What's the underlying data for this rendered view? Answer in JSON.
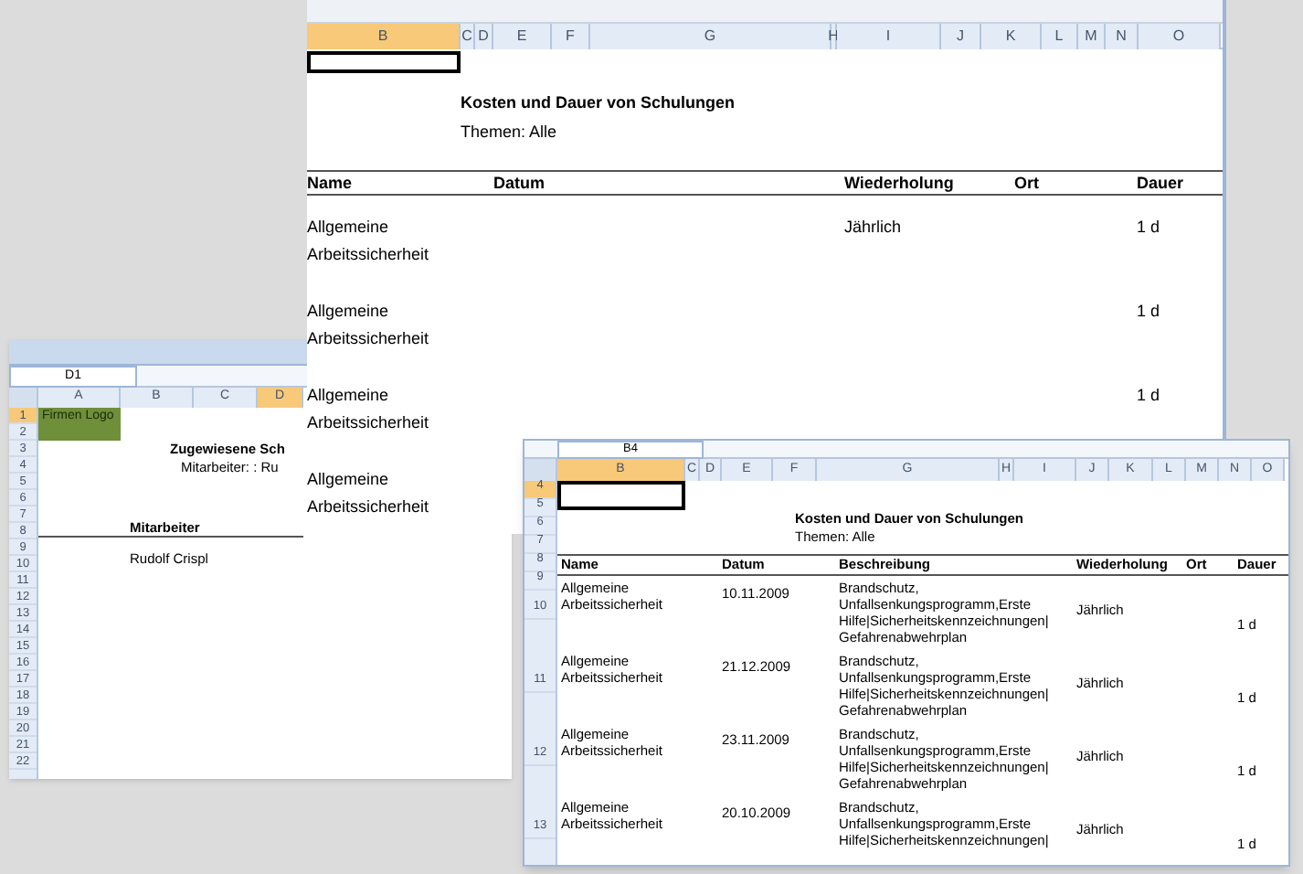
{
  "back_sheet": {
    "columns": [
      {
        "label": "B",
        "selected": true
      },
      {
        "label": "C",
        "selected": false
      },
      {
        "label": "D",
        "selected": false
      },
      {
        "label": "E",
        "selected": false
      },
      {
        "label": "F",
        "selected": false
      },
      {
        "label": "G",
        "selected": false
      },
      {
        "label": "H",
        "selected": false
      },
      {
        "label": "I",
        "selected": false
      },
      {
        "label": "J",
        "selected": false
      },
      {
        "label": "K",
        "selected": false
      },
      {
        "label": "L",
        "selected": false
      },
      {
        "label": "M",
        "selected": false
      },
      {
        "label": "N",
        "selected": false
      },
      {
        "label": "O",
        "selected": false
      }
    ],
    "title": "Kosten und Dauer von Schulungen",
    "subtitle": "Themen: Alle",
    "headers": [
      {
        "kind": "name",
        "label": "Name"
      },
      {
        "kind": "date",
        "label": "Datum"
      },
      {
        "kind": "repeat",
        "label": "Wiederholung"
      },
      {
        "kind": "place",
        "label": "Ort"
      },
      {
        "kind": "duration",
        "label": "Dauer"
      }
    ],
    "rows": [
      {
        "name": "Allgemeine Arbeitssicherheit",
        "repeat": "Jährlich",
        "duration": "1 d"
      },
      {
        "name": "Allgemeine Arbeitssicherheit",
        "duration": "1 d"
      },
      {
        "name": "Allgemeine Arbeitssicherheit",
        "duration": "1 d"
      },
      {
        "name": "Allgemeine Arbeitssicherheit"
      }
    ]
  },
  "left_sheet": {
    "name_box": "D1",
    "columns": [
      {
        "label": "A",
        "selected": false
      },
      {
        "label": "B",
        "selected": false
      },
      {
        "label": "C",
        "selected": false
      },
      {
        "label": "D",
        "selected": true
      }
    ],
    "rows": [
      {
        "label": "1",
        "selected": true
      },
      {
        "label": "2",
        "selected": false
      },
      {
        "label": "3",
        "selected": false
      },
      {
        "label": "4",
        "selected": false
      },
      {
        "label": "5",
        "selected": false
      },
      {
        "label": "6",
        "selected": false
      },
      {
        "label": "7",
        "selected": false
      },
      {
        "label": "8",
        "selected": false
      },
      {
        "label": "9",
        "selected": false
      },
      {
        "label": "10",
        "selected": false
      },
      {
        "label": "11",
        "selected": false
      },
      {
        "label": "12",
        "selected": false
      },
      {
        "label": "13",
        "selected": false
      },
      {
        "label": "14",
        "selected": false
      },
      {
        "label": "15",
        "selected": false
      },
      {
        "label": "16",
        "selected": false
      },
      {
        "label": "17",
        "selected": false
      },
      {
        "label": "18",
        "selected": false
      },
      {
        "label": "19",
        "selected": false
      },
      {
        "label": "20",
        "selected": false
      },
      {
        "label": "21",
        "selected": false
      },
      {
        "label": "22",
        "selected": false
      }
    ],
    "logo_cell": "Firmen Logo",
    "title": "Zugewiesene Sch",
    "subtitle": "Mitarbeiter: : Ru",
    "header": "Mitarbeiter",
    "employee": "Rudolf Crispl"
  },
  "front_sheet": {
    "name_box": "B4",
    "columns": [
      {
        "label": "B",
        "selected": true
      },
      {
        "label": "C",
        "selected": false
      },
      {
        "label": "D",
        "selected": false
      },
      {
        "label": "E",
        "selected": false
      },
      {
        "label": "F",
        "selected": false
      },
      {
        "label": "G",
        "selected": false
      },
      {
        "label": "H",
        "selected": false
      },
      {
        "label": "I",
        "selected": false
      },
      {
        "label": "J",
        "selected": false
      },
      {
        "label": "K",
        "selected": false
      },
      {
        "label": "L",
        "selected": false
      },
      {
        "label": "M",
        "selected": false
      },
      {
        "label": "N",
        "selected": false
      },
      {
        "label": "O",
        "selected": false
      }
    ],
    "rows": [
      {
        "label": "4",
        "selected": true
      },
      {
        "label": "5",
        "selected": false
      },
      {
        "label": "6",
        "selected": false
      },
      {
        "label": "7",
        "selected": false
      },
      {
        "label": "8",
        "selected": false
      },
      {
        "label": "9",
        "selected": false
      },
      {
        "label": "10",
        "selected": false
      },
      {
        "label": "11",
        "selected": false
      },
      {
        "label": "12",
        "selected": false
      },
      {
        "label": "13",
        "selected": false
      }
    ],
    "title": "Kosten und Dauer von Schulungen",
    "subtitle": "Themen: Alle",
    "headers": [
      {
        "kind": "name",
        "label": "Name"
      },
      {
        "kind": "date",
        "label": "Datum"
      },
      {
        "kind": "description",
        "label": "Beschreibung"
      },
      {
        "kind": "repeat",
        "label": "Wiederholung"
      },
      {
        "kind": "place",
        "label": "Ort"
      },
      {
        "kind": "duration",
        "label": "Dauer"
      }
    ],
    "entries": [
      {
        "name": "Allgemeine Arbeitssicherheit",
        "date": "10.11.2009",
        "description": [
          "Brandschutz,",
          "Unfallsenkungsprogramm,Erste",
          "Hilfe|Sicherheitskennzeichnungen|",
          "Gefahrenabwehrplan"
        ],
        "repeat": "Jährlich",
        "duration": "1 d"
      },
      {
        "name": "Allgemeine Arbeitssicherheit",
        "date": "21.12.2009",
        "description": [
          "Brandschutz,",
          "Unfallsenkungsprogramm,Erste",
          "Hilfe|Sicherheitskennzeichnungen|",
          "Gefahrenabwehrplan"
        ],
        "repeat": "Jährlich",
        "duration": "1 d"
      },
      {
        "name": "Allgemeine Arbeitssicherheit",
        "date": "23.11.2009",
        "description": [
          "Brandschutz,",
          "Unfallsenkungsprogramm,Erste",
          "Hilfe|Sicherheitskennzeichnungen|",
          "Gefahrenabwehrplan"
        ],
        "repeat": "Jährlich",
        "duration": "1 d"
      },
      {
        "name": "Allgemeine Arbeitssicherheit",
        "date": "20.10.2009",
        "description": [
          "Brandschutz,",
          "Unfallsenkungsprogramm,Erste",
          "Hilfe|Sicherheitskennzeichnungen|"
        ],
        "repeat": "Jährlich",
        "duration": "1 d"
      }
    ]
  }
}
